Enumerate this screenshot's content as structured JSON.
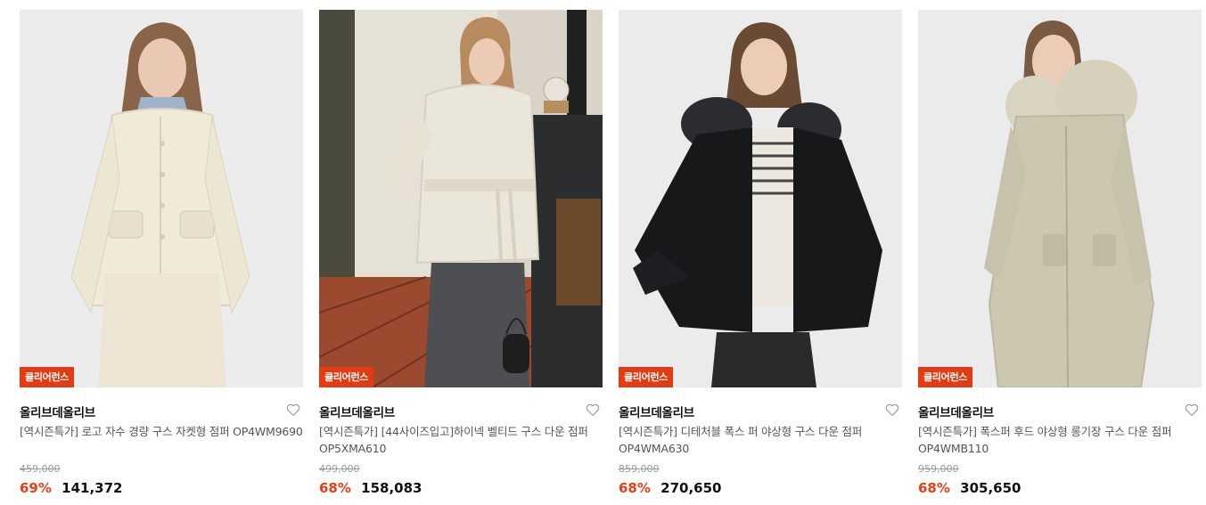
{
  "colors": {
    "badge_bg": "#e33b12",
    "discount": "#ee3d15",
    "heart": "#9a9a9a"
  },
  "products": [
    {
      "badge": "클리어런스",
      "brand": "올리브데올리브",
      "title": "[역시즌특가] 로고 자수 경량 구스 자켓형 점퍼 OP4WM9690",
      "original_price": "459,000",
      "discount": "69%",
      "price": "141,372",
      "wish_icon": "heart-outline-icon",
      "image": "model-in-cream-quilted-down-jacket"
    },
    {
      "badge": "클리어런스",
      "brand": "올리브데올리브",
      "title": "[역시즌특가] [44사이즈입고]하이넥 벨티드 구스 다운 점퍼 OP5XMA610",
      "original_price": "499,000",
      "discount": "68%",
      "price": "158,083",
      "wish_icon": "heart-outline-icon",
      "image": "model-in-ivory-belted-down-jacket-by-stove"
    },
    {
      "badge": "클리어런스",
      "brand": "올리브데올리브",
      "title": "[역시즌특가] 디테처블 폭스 퍼 야상형 구스 다운 점퍼 OP4WMA630",
      "original_price": "859,000",
      "discount": "68%",
      "price": "270,650",
      "wish_icon": "heart-outline-icon",
      "image": "model-in-black-fur-hood-down-jacket"
    },
    {
      "badge": "클리어런스",
      "brand": "올리브데올리브",
      "title": "[역시즌특가] 폭스퍼 후드 야상형 롱기장 구스 다운 점퍼 OP4WMB110",
      "original_price": "959,000",
      "discount": "68%",
      "price": "305,650",
      "wish_icon": "heart-outline-icon",
      "image": "model-in-beige-long-fur-hood-parka"
    }
  ]
}
